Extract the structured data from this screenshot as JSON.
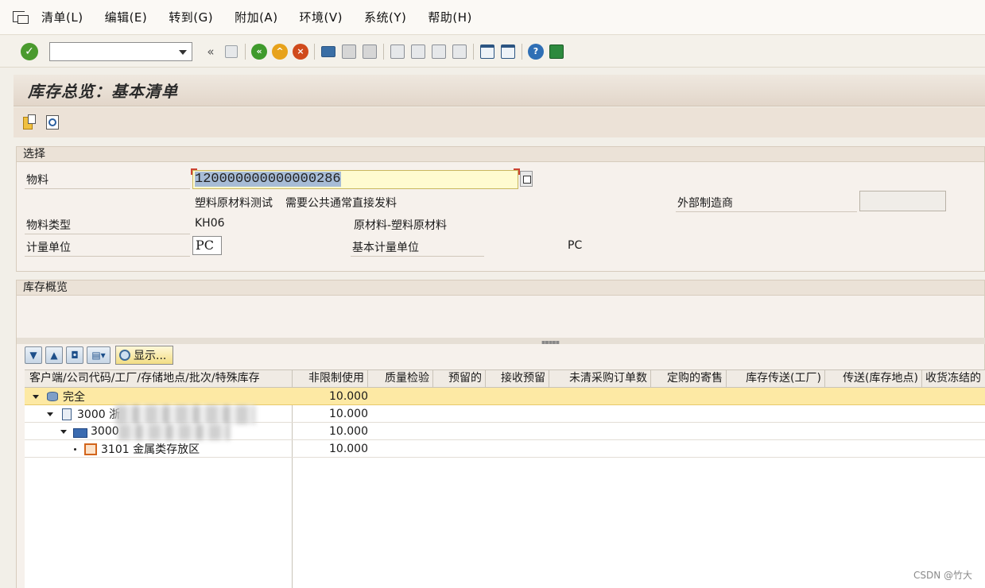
{
  "menubar": {
    "items": [
      "清单(L)",
      "编辑(E)",
      "转到(G)",
      "附加(A)",
      "环境(V)",
      "系统(Y)",
      "帮助(H)"
    ]
  },
  "toolbar": {
    "command_value": "",
    "icons": [
      "enter-icon",
      "save-icon",
      "back-icon",
      "exit-icon",
      "cancel-icon",
      "print-icon",
      "find-icon",
      "find-next-icon",
      "first-page-icon",
      "previous-page-icon",
      "next-page-icon",
      "last-page-icon",
      "create-session-icon",
      "shortcut-icon",
      "help-icon",
      "customize-layout-icon"
    ]
  },
  "page": {
    "title": "库存总览：基本清单"
  },
  "selection": {
    "header": "选择",
    "material_label": "物料",
    "material_value": "120000000000000286",
    "material_desc_1": "塑料原材料测试",
    "material_desc_2": "需要公共通常直接发料",
    "manufacturer_label": "外部制造商",
    "material_type_label": "物料类型",
    "material_type_value": "KH06",
    "material_type_desc": "原材料-塑料原材料",
    "uom_label": "计量单位",
    "uom_value": "PC",
    "base_uom_label": "基本计量单位",
    "base_uom_value": "PC"
  },
  "overview": {
    "header": "库存概览",
    "display_button": "显示...",
    "columns": [
      "客户端/公司代码/工厂/存储地点/批次/特殊库存",
      "非限制使用",
      "质量检验",
      "预留的",
      "接收预留",
      "未清采购订单数",
      "定购的寄售",
      "库存传送(工厂)",
      "传送(库存地点)",
      "收货冻结的"
    ],
    "rows": [
      {
        "label": "完全",
        "unrestricted": "10.000"
      },
      {
        "label": "3000 浙",
        "unrestricted": "10.000"
      },
      {
        "label": "3000",
        "unrestricted": "10.000"
      },
      {
        "label": "3101 金属类存放区",
        "unrestricted": "10.000"
      }
    ]
  },
  "watermark": "CSDN @竹大",
  "colors": {
    "highlight_row": "#fde9a4",
    "title_bg": "#e2d6ca",
    "input_bg": "#fffbd0"
  }
}
